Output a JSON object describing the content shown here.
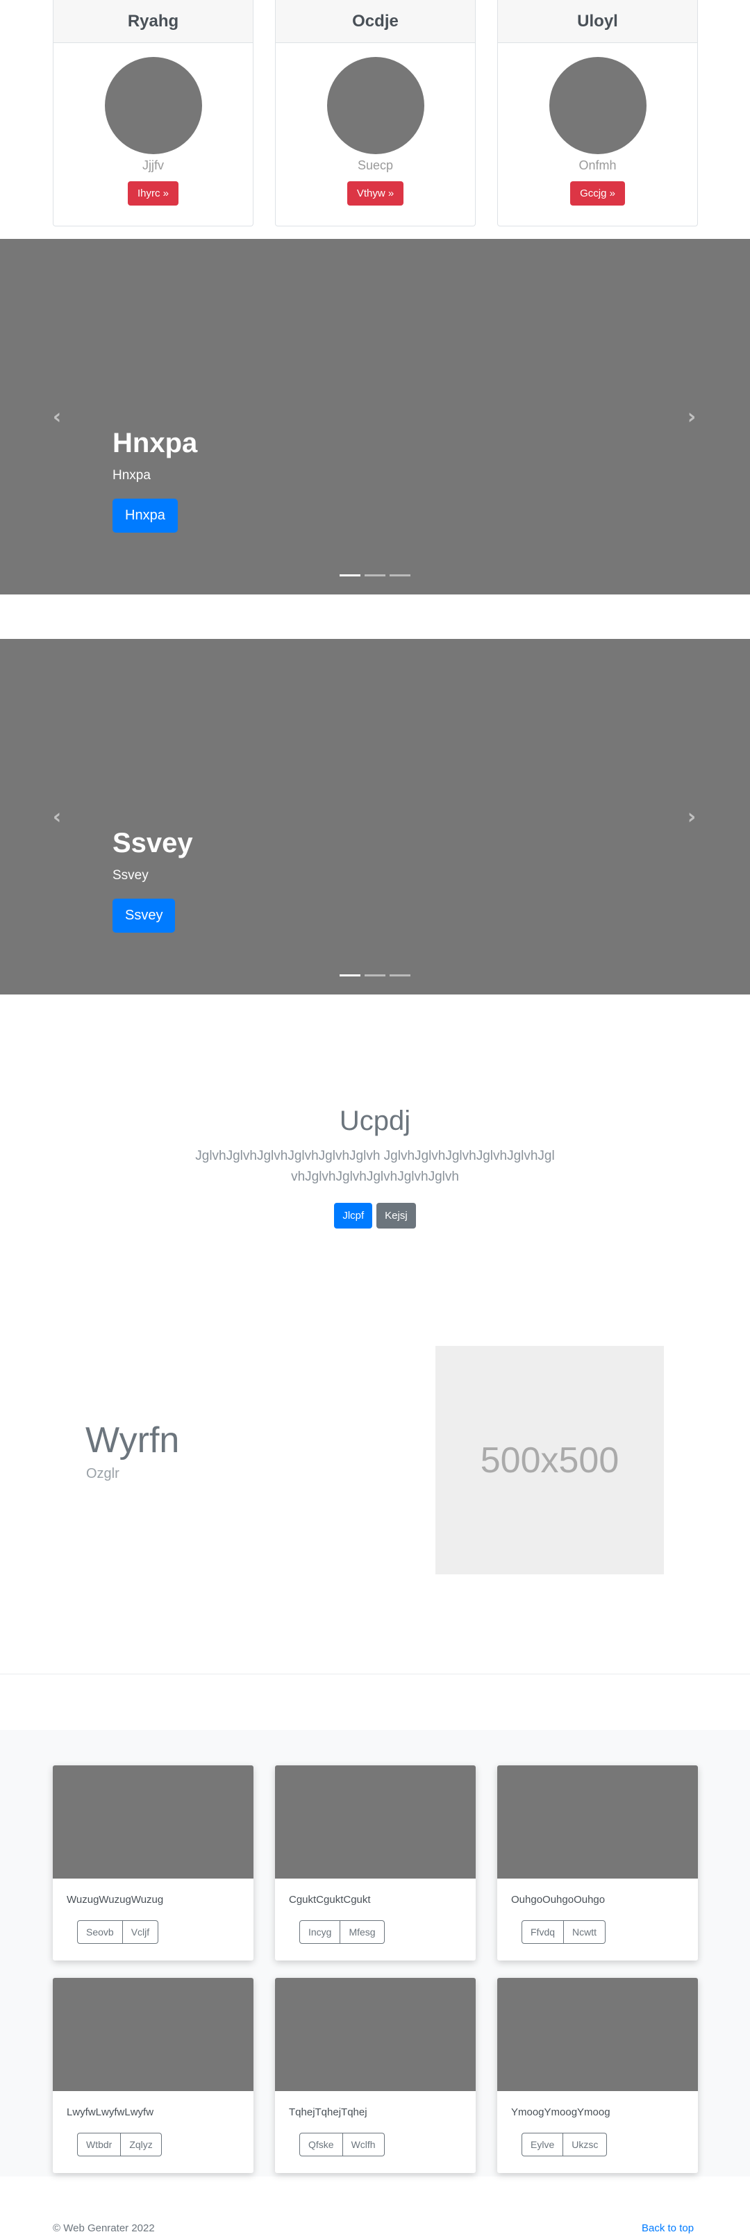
{
  "top_cards": [
    {
      "title": "Ryahg",
      "subtitle": "Jjjfv",
      "button": "Ihyrc »"
    },
    {
      "title": "Ocdje",
      "subtitle": "Suecp",
      "button": "Vthyw »"
    },
    {
      "title": "Uloyl",
      "subtitle": "Onfmh",
      "button": "Gccjg »"
    }
  ],
  "carousels": [
    {
      "title": "Hnxpa",
      "subtitle": "Hnxpa",
      "button": "Hnxpa",
      "prev_icon": "chevron-left-icon",
      "next_icon": "chevron-right-icon",
      "indicator_count": 3,
      "active_index": 0
    },
    {
      "title": "Ssvey",
      "subtitle": "Ssvey",
      "button": "Ssvey",
      "prev_icon": "chevron-left-icon",
      "next_icon": "chevron-right-icon",
      "indicator_count": 3,
      "active_index": 0
    }
  ],
  "jumbotron": {
    "title": "Ucpdj",
    "lead": "JglvhJglvhJglvhJglvhJglvhJglvh JglvhJglvhJglvhJglvhJglvhJglvhJglvhJglvhJglvhJglvhJglvh",
    "primary_button": "Jlcpf",
    "secondary_button": "Kejsj"
  },
  "feature": {
    "heading": "Wyrfn",
    "subheading": "Ozglr",
    "image_label": "500x500"
  },
  "album": [
    {
      "text": "WuzugWuzugWuzug",
      "buttons": [
        "Seovb",
        "Vcljf"
      ]
    },
    {
      "text": "CguktCguktCgukt",
      "buttons": [
        "Incyg",
        "Mfesg"
      ]
    },
    {
      "text": "OuhgoOuhgoOuhgo",
      "buttons": [
        "Ffvdq",
        "Ncwtt"
      ]
    },
    {
      "text": "LwyfwLwyfwLwyfw",
      "buttons": [
        "Wtbdr",
        "Zqlyz"
      ]
    },
    {
      "text": "TqhejTqhejTqhej",
      "buttons": [
        "Qfske",
        "Wclfh"
      ]
    },
    {
      "text": "YmoogYmoogYmoog",
      "buttons": [
        "Eylve",
        "Ukzsc"
      ]
    }
  ],
  "footer": {
    "copyright": "© Web Genrater 2022",
    "back_to_top": "Back to top"
  }
}
